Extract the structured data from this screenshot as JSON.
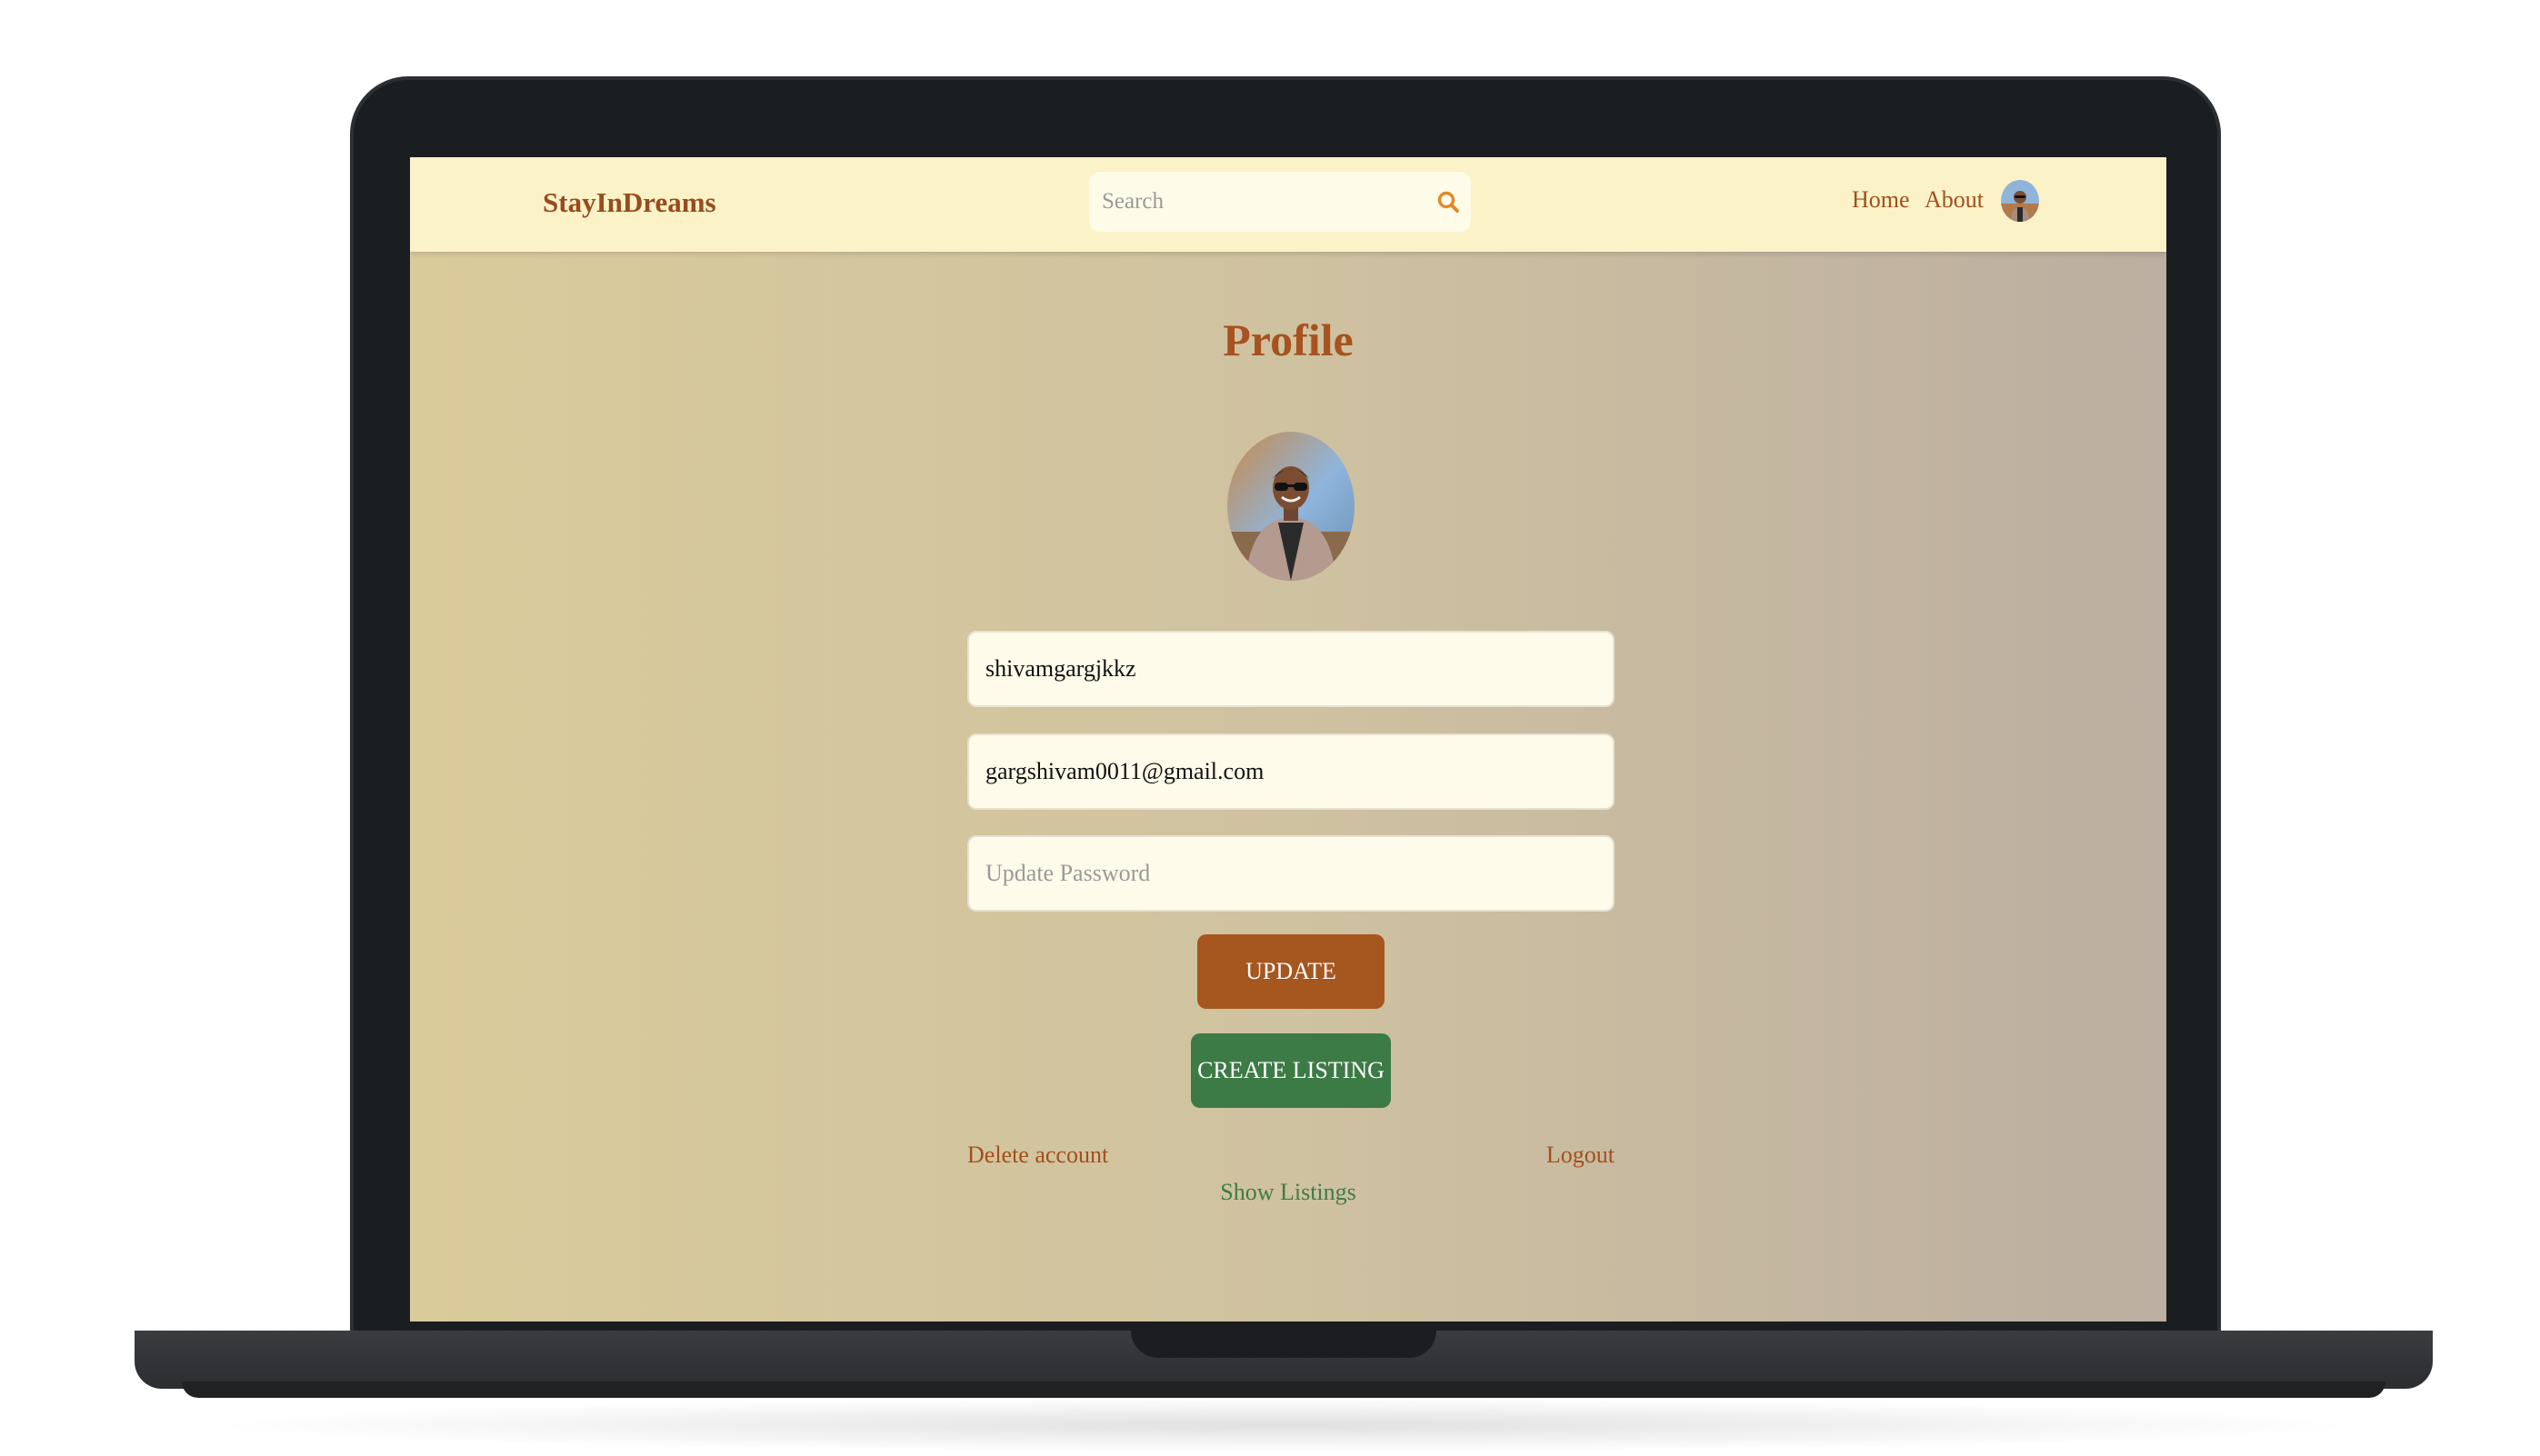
{
  "navbar": {
    "brand": "StayInDreams",
    "search_placeholder": "Search",
    "links": [
      "Home",
      "About"
    ]
  },
  "profile": {
    "title": "Profile",
    "username": "shivamgargjkkz",
    "email": "gargshivam0011@gmail.com",
    "password_placeholder": "Update Password",
    "update_label": "UPDATE",
    "create_listing_label": "CREATE LISTING",
    "delete_account_label": "Delete account",
    "logout_label": "Logout",
    "show_listings_label": "Show Listings"
  },
  "colors": {
    "accent": "#a6561f",
    "success": "#3c7b45",
    "navbar_bg": "#fbf2c8"
  },
  "icons": {
    "search": "search-icon",
    "avatar": "avatar"
  }
}
